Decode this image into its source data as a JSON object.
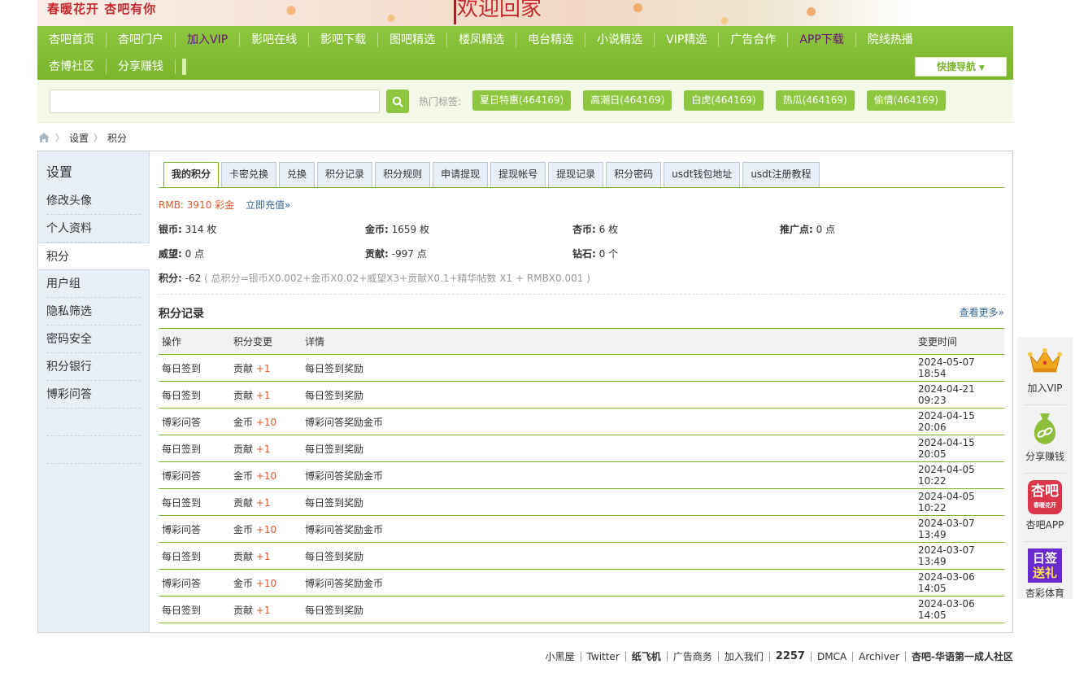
{
  "banner": {
    "slogan": "春暖花开  杏吧有你",
    "welcome": "欢迎回家"
  },
  "nav": {
    "row1": [
      {
        "label": "杏吧首页",
        "purple": false
      },
      {
        "label": "杏吧门户",
        "purple": false
      },
      {
        "label": "加入VIP",
        "purple": true
      },
      {
        "label": "影吧在线",
        "purple": false
      },
      {
        "label": "影吧下载",
        "purple": false
      },
      {
        "label": "图吧精选",
        "purple": false
      },
      {
        "label": "楼凤精选",
        "purple": false
      },
      {
        "label": "电台精选",
        "purple": false
      },
      {
        "label": "小说精选",
        "purple": false
      },
      {
        "label": "VIP精选",
        "purple": false
      },
      {
        "label": "广告合作",
        "purple": false
      },
      {
        "label": "APP下载",
        "purple": true
      },
      {
        "label": "院线热播",
        "purple": false
      }
    ],
    "row2": [
      {
        "label": "杏博社区"
      },
      {
        "label": "分享赚钱"
      }
    ],
    "quick_nav": "快捷导航"
  },
  "search": {
    "placeholder": "",
    "hot_label": "热门标签:",
    "tags": [
      "夏日特惠(464169)",
      "高潮日(464169)",
      "白虎(464169)",
      "热瓜(464169)",
      "偷情(464169)"
    ]
  },
  "breadcrumb": {
    "items": [
      "设置",
      "积分"
    ]
  },
  "sidebar": {
    "title": "设置",
    "items": [
      "修改头像",
      "个人资料",
      "积分",
      "用户组",
      "隐私筛选",
      "密码安全",
      "积分银行",
      "博彩问答"
    ],
    "active": "积分"
  },
  "tabs": [
    "我的积分",
    "卡密兑换",
    "兑换",
    "积分记录",
    "积分规则",
    "申请提现",
    "提现帐号",
    "提现记录",
    "积分密码",
    "usdt钱包地址",
    "usdt注册教程"
  ],
  "rmb": {
    "label": "RMB:",
    "value": "3910 彩金",
    "recharge": "立即充值»"
  },
  "stats": {
    "silver": {
      "label": "银币:",
      "value": "314 枚"
    },
    "gold": {
      "label": "金币:",
      "value": "1659 枚"
    },
    "xing": {
      "label": "杏币:",
      "value": "6 枚"
    },
    "promo": {
      "label": "推广点:",
      "value": "0 点"
    },
    "prestige": {
      "label": "威望:",
      "value": "0 点"
    },
    "contrib": {
      "label": "贡献:",
      "value": "-997 点"
    },
    "diamond": {
      "label": "钻石:",
      "value": "0 个"
    }
  },
  "total": {
    "label": "积分:",
    "value": "-62",
    "note": "( 总积分=银币X0.002+金币X0.02+威望X3+贡献X0.1+精华帖数 X1 + RMBX0.001 )"
  },
  "records": {
    "title": "积分记录",
    "more": "查看更多»",
    "headers": [
      "操作",
      "积分变更",
      "详情",
      "变更时间"
    ],
    "rows": [
      {
        "op": "每日签到",
        "type": "贡献",
        "delta": "+1",
        "detail": "每日签到奖励",
        "time": "2024-05-07 18:54"
      },
      {
        "op": "每日签到",
        "type": "贡献",
        "delta": "+1",
        "detail": "每日签到奖励",
        "time": "2024-04-21 09:23"
      },
      {
        "op": "博彩问答",
        "type": "金币",
        "delta": "+10",
        "detail": "博彩问答奖励金币",
        "time": "2024-04-15 20:06"
      },
      {
        "op": "每日签到",
        "type": "贡献",
        "delta": "+1",
        "detail": "每日签到奖励",
        "time": "2024-04-15 20:05"
      },
      {
        "op": "博彩问答",
        "type": "金币",
        "delta": "+10",
        "detail": "博彩问答奖励金币",
        "time": "2024-04-05 10:22"
      },
      {
        "op": "每日签到",
        "type": "贡献",
        "delta": "+1",
        "detail": "每日签到奖励",
        "time": "2024-04-05 10:22"
      },
      {
        "op": "博彩问答",
        "type": "金币",
        "delta": "+10",
        "detail": "博彩问答奖励金币",
        "time": "2024-03-07 13:49"
      },
      {
        "op": "每日签到",
        "type": "贡献",
        "delta": "+1",
        "detail": "每日签到奖励",
        "time": "2024-03-07 13:49"
      },
      {
        "op": "博彩问答",
        "type": "金币",
        "delta": "+10",
        "detail": "博彩问答奖励金币",
        "time": "2024-03-06 14:05"
      },
      {
        "op": "每日签到",
        "type": "贡献",
        "delta": "+1",
        "detail": "每日签到奖励",
        "time": "2024-03-06 14:05"
      }
    ]
  },
  "floatbar": [
    {
      "label": "加入VIP",
      "icon": "crown-icon"
    },
    {
      "label": "分享赚钱",
      "icon": "money-bag-icon"
    },
    {
      "label": "杏吧APP",
      "icon": "app-logo-icon",
      "badge": "杏吧",
      "badge_sub": "春暖花开"
    },
    {
      "label": "杏彩体育",
      "icon": "daily-gift-icon",
      "badge": "日签",
      "badge_sub": "送礼"
    }
  ],
  "footer": {
    "links": [
      "小黑屋",
      "Twitter",
      "纸飞机",
      "广告商务",
      "加入我们",
      "2257",
      "DMCA",
      "Archiver",
      "杏吧-华语第一成人社区"
    ]
  },
  "colors": {
    "accent_green": "#8dc63f",
    "nav_purple": "#6b0f78",
    "highlight_orange": "#e0582c",
    "link_blue": "#336699"
  }
}
